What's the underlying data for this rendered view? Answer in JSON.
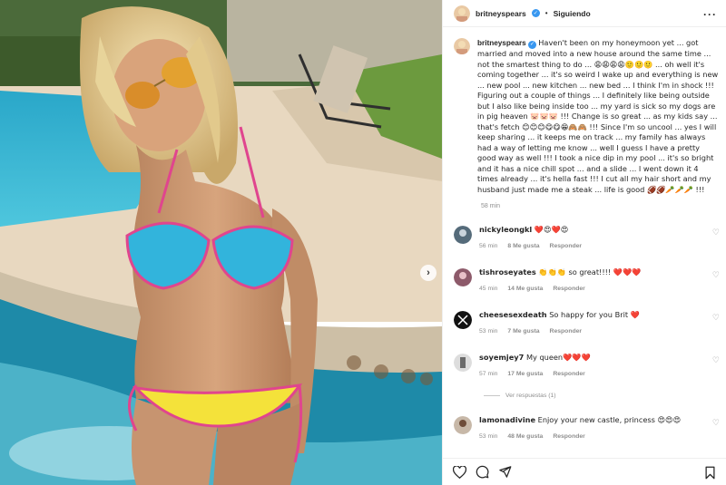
{
  "post": {
    "author": "britneyspears",
    "follow_label": "Siguiendo",
    "caption": "Haven't been on my honeymoon yet ... got married and moved into a new house around the same time ... not the smartest thing to do ... 😩😩😩😩🙂🙂🙂 ... oh well it's coming together ... it's so weird I wake up and everything is new ... new pool ... new kitchen ... new bed ... I think I'm in shock !!! Figuring out a couple of things ... I definitely like being outside but I also like being inside too ... my yard is sick so my dogs are in pig heaven 🐷🐷🐷 !!! Change is so great ... as my kids say ... that's fetch 😊😊😊😋😋😁🙈🙈 !!! Since I'm so uncool ... yes I will keep sharing ... it keeps me on track ... my family has always had a way of letting me know ... well I guess I have a pretty good way as well !!! I took a nice dip in my pool ... it's so bright and it has a nice chill spot ... and a slide ... I went down it 4 times already ... it's hella fast !!! I cut all my hair short and my husband just made me a steak ... life is good 🏈🏈🥕🥕🥕 !!!",
    "time": "58 min"
  },
  "comments": [
    {
      "user": "nickyleongkl",
      "text": "❤️😍❤️😍",
      "time": "56 min",
      "likes": "8 Me gusta",
      "reply": "Responder"
    },
    {
      "user": "tishroseyates",
      "text": "👏👏👏 so great!!!! ❤️❤️❤️",
      "time": "45 min",
      "likes": "14 Me gusta",
      "reply": "Responder"
    },
    {
      "user": "cheesesexdeath",
      "text": "So happy for you Brit ❤️",
      "time": "53 min",
      "likes": "7 Me gusta",
      "reply": "Responder"
    },
    {
      "user": "soyemjey7",
      "text": "My queen❤️❤️❤️",
      "time": "57 min",
      "likes": "17 Me gusta",
      "reply": "Responder"
    },
    {
      "user": "lamonadivine",
      "text": "Enjoy your new castle, princess 😍😍😍",
      "time": "53 min",
      "likes": "48 Me gusta",
      "reply": "Responder"
    }
  ],
  "view_replies": "Ver respuestas (1)",
  "icons": {
    "like": "heart-icon",
    "comment": "comment-icon",
    "share": "send-icon",
    "save": "bookmark-icon",
    "more": "more-options-icon",
    "next": "chevron-right-icon"
  },
  "colors": {
    "verified": "#3897f0",
    "heart": "#ed4956",
    "muted": "#8e8e8e"
  }
}
